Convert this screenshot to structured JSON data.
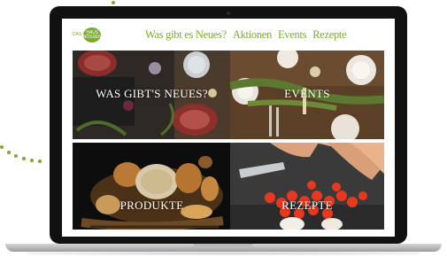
{
  "site": {
    "logo_top": "DAS",
    "logo_circle": "HAUS NÖSSEN",
    "logo_bottom": "",
    "nav": [
      "Was gibt es Neues?",
      "Aktionen",
      "Events",
      "Rezepte"
    ]
  },
  "tiles": [
    {
      "label": "WAS GIBT'S NEUES?",
      "image": "steaks-on-board"
    },
    {
      "label": "EVENTS",
      "image": "set-dinner-table"
    },
    {
      "label": "PRODUKTE",
      "image": "bread-basket"
    },
    {
      "label": "REZEPTE",
      "image": "cutting-tomatoes"
    }
  ],
  "colors": {
    "brand_green": "#7bab2e",
    "laptop_frame": "#111111",
    "laptop_base": "#c9c9c9"
  }
}
